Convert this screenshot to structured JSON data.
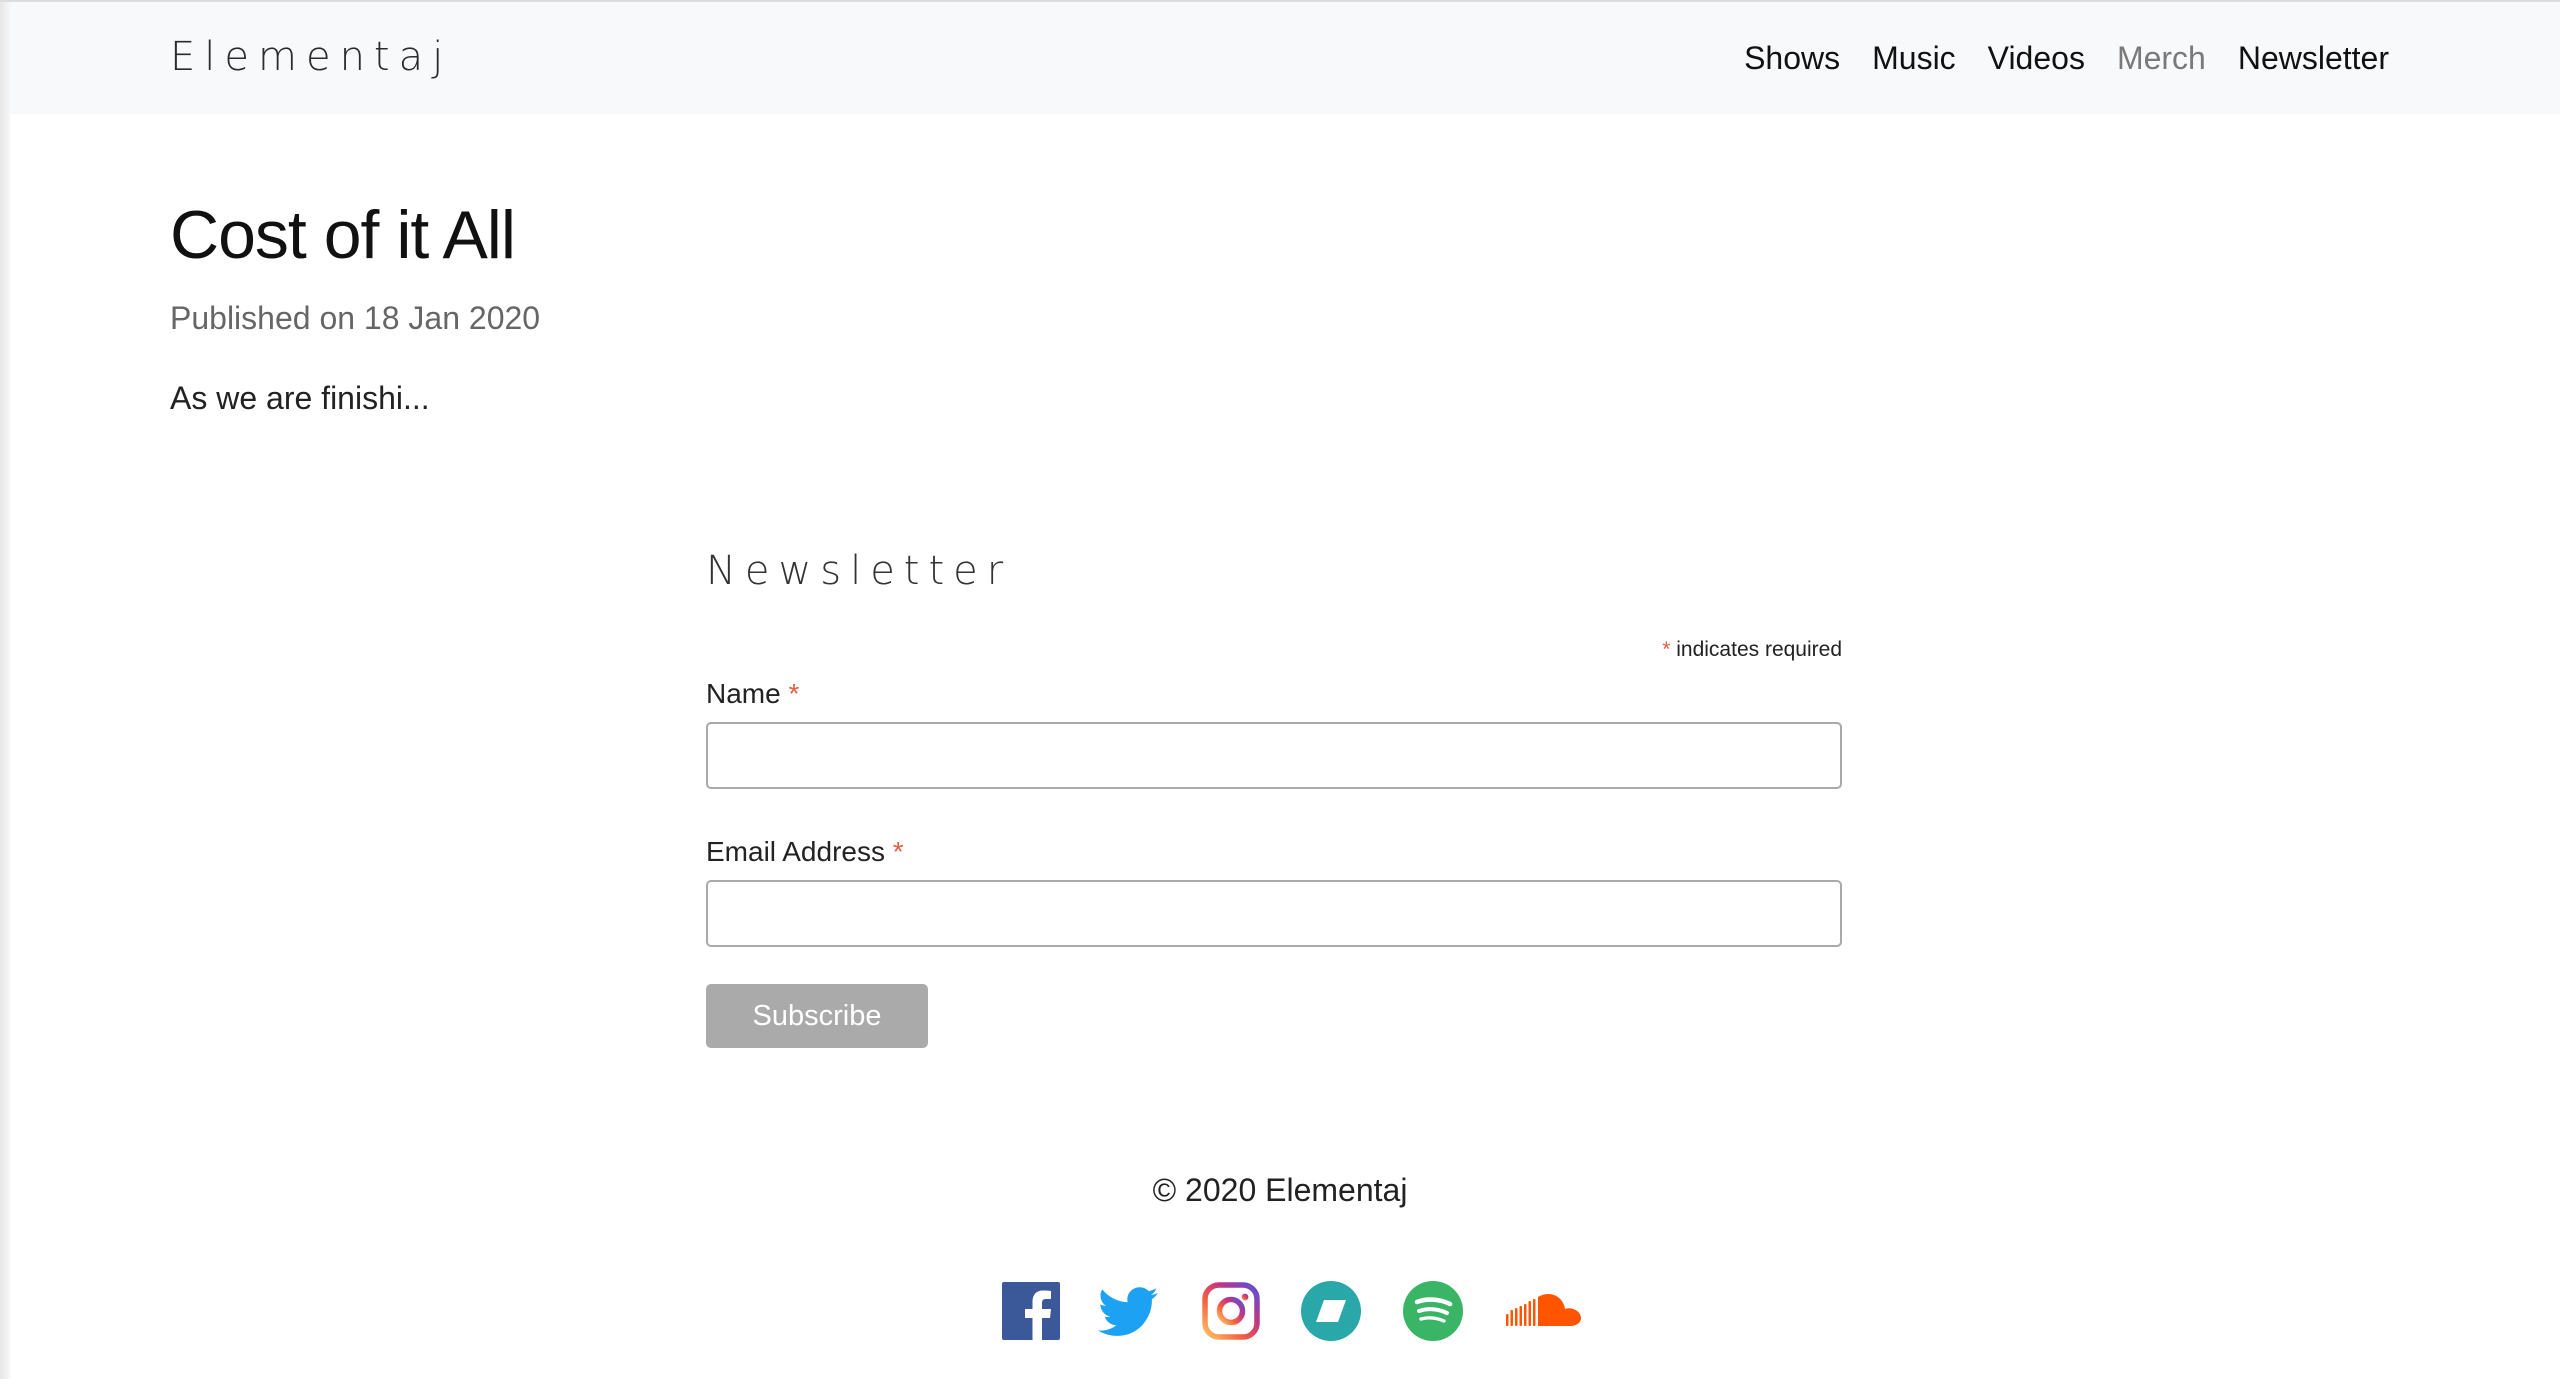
{
  "navbar": {
    "brand": "Elementaj",
    "links": [
      {
        "label": "Shows"
      },
      {
        "label": "Music"
      },
      {
        "label": "Videos"
      },
      {
        "label": "Merch"
      },
      {
        "label": "Newsletter"
      }
    ]
  },
  "post": {
    "title": "Cost of it All",
    "meta": "Published on 18 Jan 2020",
    "excerpt": "As we are finishi..."
  },
  "newsletter": {
    "heading": "Newsletter",
    "required_asterisk": "*",
    "required_note": "indicates required",
    "name_label": "Name",
    "email_label": "Email Address",
    "name_value": "",
    "email_value": "",
    "subscribe_label": "Subscribe"
  },
  "footer": {
    "copyright": "© 2020 Elementaj",
    "social_icons": [
      "facebook-icon",
      "twitter-icon",
      "instagram-icon",
      "bandcamp-icon",
      "spotify-icon",
      "soundcloud-icon"
    ]
  },
  "colors": {
    "navbar_bg": "#f8f9fa",
    "muted_link": "#7a7a7a",
    "required": "#e85c41",
    "button_bg": "#aaaaaa",
    "facebook": "#3b5998",
    "twitter": "#1da1f2",
    "bandcamp": "#2aa8a9",
    "spotify": "#3ab566",
    "soundcloud": "#ff5500"
  }
}
